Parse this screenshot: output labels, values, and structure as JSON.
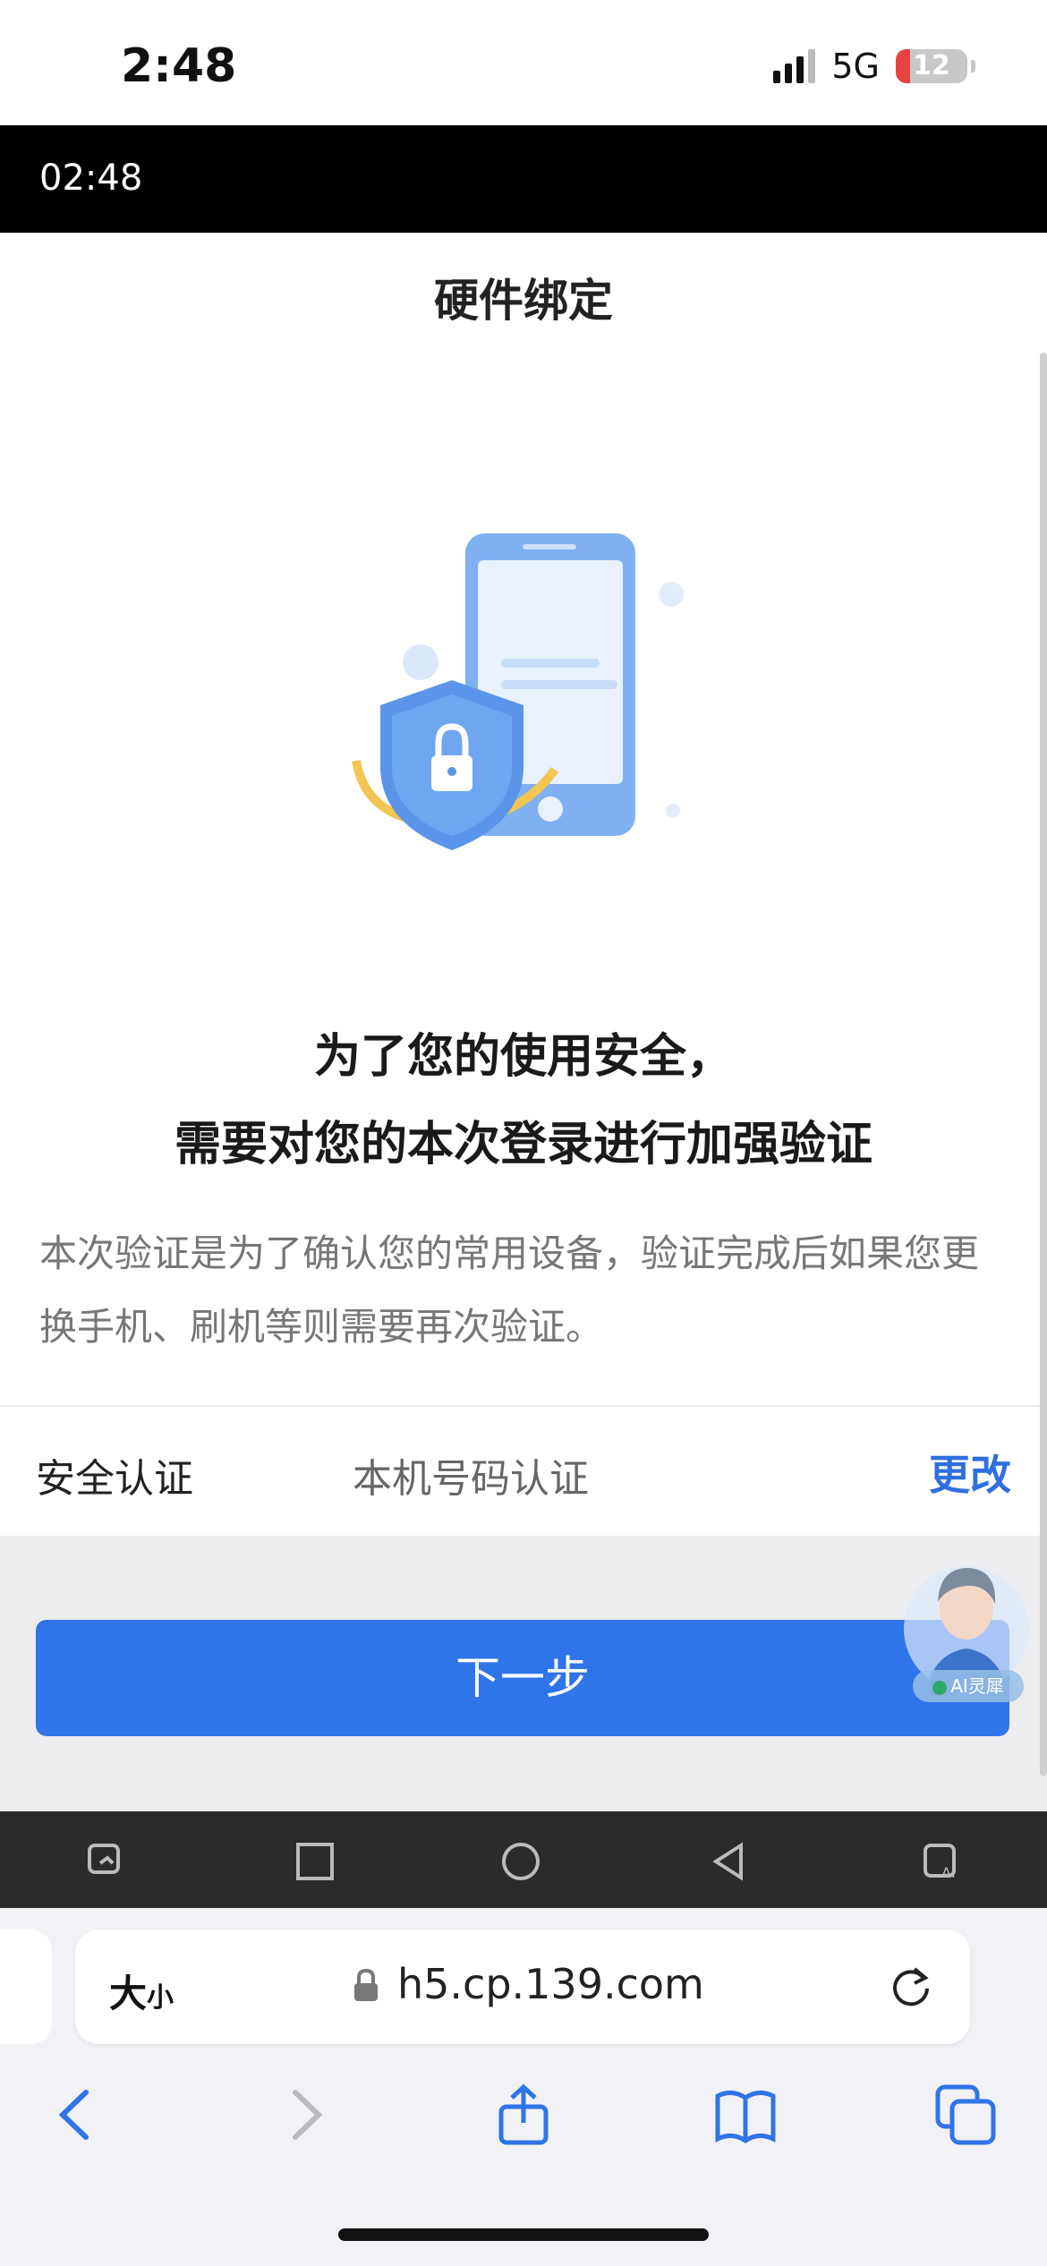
{
  "status_bar": {
    "time": "2:48",
    "network": "5G",
    "battery_level": "12"
  },
  "overlay": {
    "time": "02:48"
  },
  "header": {
    "title": "硬件绑定"
  },
  "content": {
    "headline_line1": "为了您的使用安全，",
    "headline_line2": "需要对您的本次登录进行加强验证",
    "description": "本次验证是为了确认您的常用设备，验证完成后如果您更换手机、刷机等则需要再次验证。"
  },
  "auth_row": {
    "label": "安全认证",
    "value": "本机号码认证",
    "action": "更改"
  },
  "next_button": {
    "label": "下一步"
  },
  "ai_assistant": {
    "badge": "AI灵犀"
  },
  "browser": {
    "text_size_big": "大",
    "text_size_small": "小",
    "url": "h5.cp.139.com"
  },
  "colors": {
    "accent": "#2f74e8",
    "link": "#2f6fe0"
  },
  "icons": {
    "nav_bar": [
      "screenshot-icon",
      "square-icon",
      "circle-icon",
      "back-triangle-icon",
      "ai-icon"
    ],
    "toolbar": [
      "back-icon",
      "forward-icon",
      "share-icon",
      "bookmarks-icon",
      "tabs-icon"
    ]
  }
}
